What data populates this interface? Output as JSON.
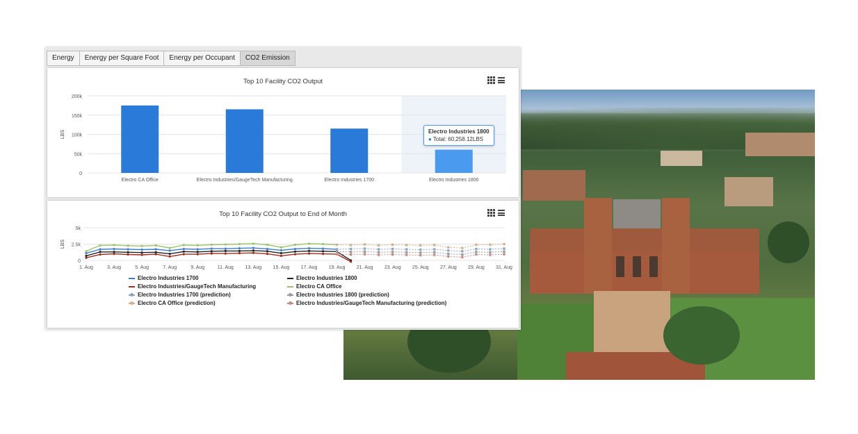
{
  "tabs": [
    "Energy",
    "Energy per Square Foot",
    "Energy per Occupant",
    "CO2 Emission"
  ],
  "active_tab": 3,
  "chart_data": [
    {
      "type": "bar",
      "title": "Top 10 Facility CO2 Output",
      "ylabel": "LBS",
      "categories": [
        "Electro CA Office",
        "Electro Industries/GaugeTech Manufacturing",
        "Electro Industries 1700",
        "Electro Industries 1800"
      ],
      "values": [
        175000,
        165000,
        115000,
        60258.12
      ],
      "ylim": [
        0,
        200000
      ],
      "yticks": [
        "0",
        "50k",
        "100k",
        "150k",
        "200k"
      ],
      "bar_color": "#2a7ad9",
      "highlight_color": "#4a9af0",
      "highlight_index": 3,
      "tooltip": {
        "title": "Electro Industries 1800",
        "label": "Total:",
        "value": "60,258.12LBS"
      }
    },
    {
      "type": "line",
      "title": "Top 10 Facility CO2 Output to End of Month",
      "ylabel": "LBS",
      "ylim": [
        0,
        5000
      ],
      "yticks": [
        "0",
        "2.5k",
        "5k"
      ],
      "x": [
        "1. Aug",
        "2. Aug",
        "3. Aug",
        "4. Aug",
        "5. Aug",
        "6. Aug",
        "7. Aug",
        "8. Aug",
        "9. Aug",
        "10. Aug",
        "11. Aug",
        "12. Aug",
        "13. Aug",
        "14. Aug",
        "15. Aug",
        "16. Aug",
        "17. Aug",
        "18. Aug",
        "19. Aug",
        "20. Aug",
        "21. Aug",
        "22. Aug",
        "23. Aug",
        "24. Aug",
        "25. Aug",
        "26. Aug",
        "27. Aug",
        "28. Aug",
        "29. Aug",
        "30. Aug",
        "31. Aug"
      ],
      "xticks": [
        "1. Aug",
        "3. Aug",
        "5. Aug",
        "7. Aug",
        "9. Aug",
        "11. Aug",
        "13. Aug",
        "15. Aug",
        "17. Aug",
        "19. Aug",
        "21. Aug",
        "23. Aug",
        "25. Aug",
        "27. Aug",
        "29. Aug",
        "31. Aug"
      ],
      "series": [
        {
          "name": "Electro Industries 1700",
          "color": "#3d7fcf",
          "style": "solid",
          "values": [
            1100,
            1700,
            1750,
            1700,
            1650,
            1700,
            1500,
            1750,
            1700,
            1800,
            1800,
            1850,
            1900,
            1750,
            1550,
            1750,
            1850,
            1800,
            1700,
            null,
            null,
            null,
            null,
            null,
            null,
            null,
            null,
            null,
            null,
            null,
            null
          ]
        },
        {
          "name": "Electro Industries 1800",
          "color": "#222222",
          "style": "solid",
          "values": [
            700,
            1300,
            1300,
            1250,
            1200,
            1250,
            1000,
            1350,
            1300,
            1400,
            1450,
            1450,
            1500,
            1400,
            1100,
            1350,
            1450,
            1400,
            1350,
            0,
            null,
            null,
            null,
            null,
            null,
            null,
            null,
            null,
            null,
            null,
            null
          ]
        },
        {
          "name": "Electro Industries/GaugeTech Manufacturing",
          "color": "#9a2f1f",
          "style": "solid",
          "values": [
            400,
            900,
            1000,
            900,
            850,
            950,
            600,
            950,
            950,
            1050,
            1050,
            1100,
            1150,
            1000,
            700,
            950,
            1050,
            1000,
            950,
            -200,
            null,
            null,
            null,
            null,
            null,
            null,
            null,
            null,
            null,
            null,
            null
          ]
        },
        {
          "name": "Electro CA Office",
          "color": "#9bc26b",
          "style": "solid",
          "values": [
            1400,
            2300,
            2350,
            2250,
            2200,
            2300,
            1900,
            2350,
            2300,
            2400,
            2450,
            2500,
            2550,
            2400,
            2000,
            2400,
            2550,
            2500,
            2400,
            null,
            null,
            null,
            null,
            null,
            null,
            null,
            null,
            null,
            null,
            null,
            null
          ]
        },
        {
          "name": "Electro Industries 1700 (prediction)",
          "color": "#8aa3c8",
          "style": "dotted",
          "values": [
            null,
            null,
            null,
            null,
            null,
            null,
            null,
            null,
            null,
            null,
            null,
            null,
            null,
            null,
            null,
            null,
            null,
            null,
            1700,
            1750,
            1800,
            1700,
            1750,
            1700,
            1650,
            1700,
            1500,
            1400,
            1750,
            1700,
            1800
          ]
        },
        {
          "name": "Electro Industries 1800 (prediction)",
          "color": "#9a9a9a",
          "style": "dotted",
          "values": [
            null,
            null,
            null,
            null,
            null,
            null,
            null,
            null,
            null,
            null,
            null,
            null,
            null,
            null,
            null,
            null,
            null,
            null,
            1350,
            1300,
            1350,
            1250,
            1300,
            1250,
            1200,
            1250,
            1000,
            900,
            1300,
            1250,
            1350
          ]
        },
        {
          "name": "Electro CA Office (prediction)",
          "color": "#d4b08a",
          "style": "dotted",
          "values": [
            null,
            null,
            null,
            null,
            null,
            null,
            null,
            null,
            null,
            null,
            null,
            null,
            null,
            null,
            null,
            null,
            null,
            null,
            2400,
            2350,
            2450,
            2300,
            2400,
            2350,
            2300,
            2350,
            2000,
            1900,
            2400,
            2400,
            2500
          ]
        },
        {
          "name": "Electro Industries/GaugeTech Manufacturing (prediction)",
          "color": "#c48a85",
          "style": "dotted",
          "values": [
            null,
            null,
            null,
            null,
            null,
            null,
            null,
            null,
            null,
            null,
            null,
            null,
            null,
            null,
            null,
            null,
            null,
            null,
            950,
            900,
            950,
            850,
            900,
            850,
            800,
            850,
            600,
            500,
            900,
            850,
            950
          ]
        }
      ]
    }
  ]
}
